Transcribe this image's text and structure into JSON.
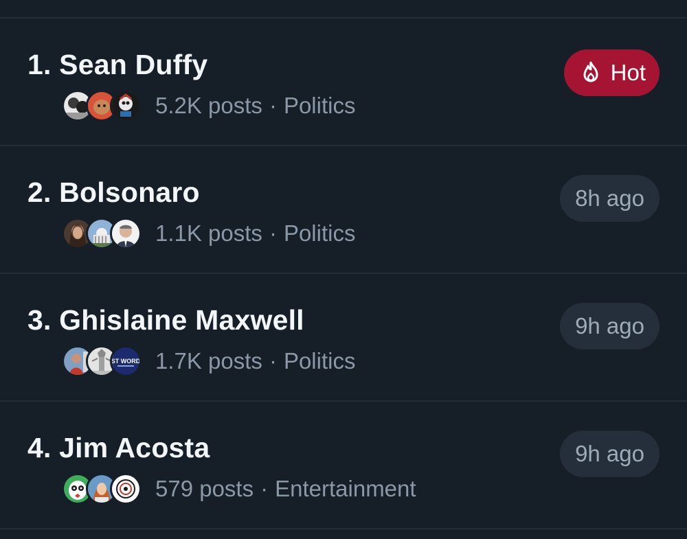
{
  "trending": [
    {
      "rank_title": "1. Sean Duffy",
      "posts": "5.2K posts",
      "category": "Politics",
      "badge": {
        "type": "hot",
        "label": "Hot",
        "icon": "flame-icon",
        "color": "#a51433"
      }
    },
    {
      "rank_title": "2. Bolsonaro",
      "posts": "1.1K posts",
      "category": "Politics",
      "badge": {
        "type": "time",
        "label": "8h ago"
      }
    },
    {
      "rank_title": "3. Ghislaine Maxwell",
      "posts": "1.7K posts",
      "category": "Politics",
      "badge": {
        "type": "time",
        "label": "9h ago"
      }
    },
    {
      "rank_title": "4. Jim Acosta",
      "posts": "579 posts",
      "category": "Entertainment",
      "badge": {
        "type": "time",
        "label": "9h ago"
      }
    }
  ],
  "separator": "·",
  "avatar_badge_text": "ST WORD",
  "colors": {
    "background": "#161e27",
    "divider": "#232d38",
    "title": "#f3f6f9",
    "meta": "#8a98a8",
    "time_badge_bg": "#252f3b",
    "hot_badge_bg": "#a51433"
  }
}
